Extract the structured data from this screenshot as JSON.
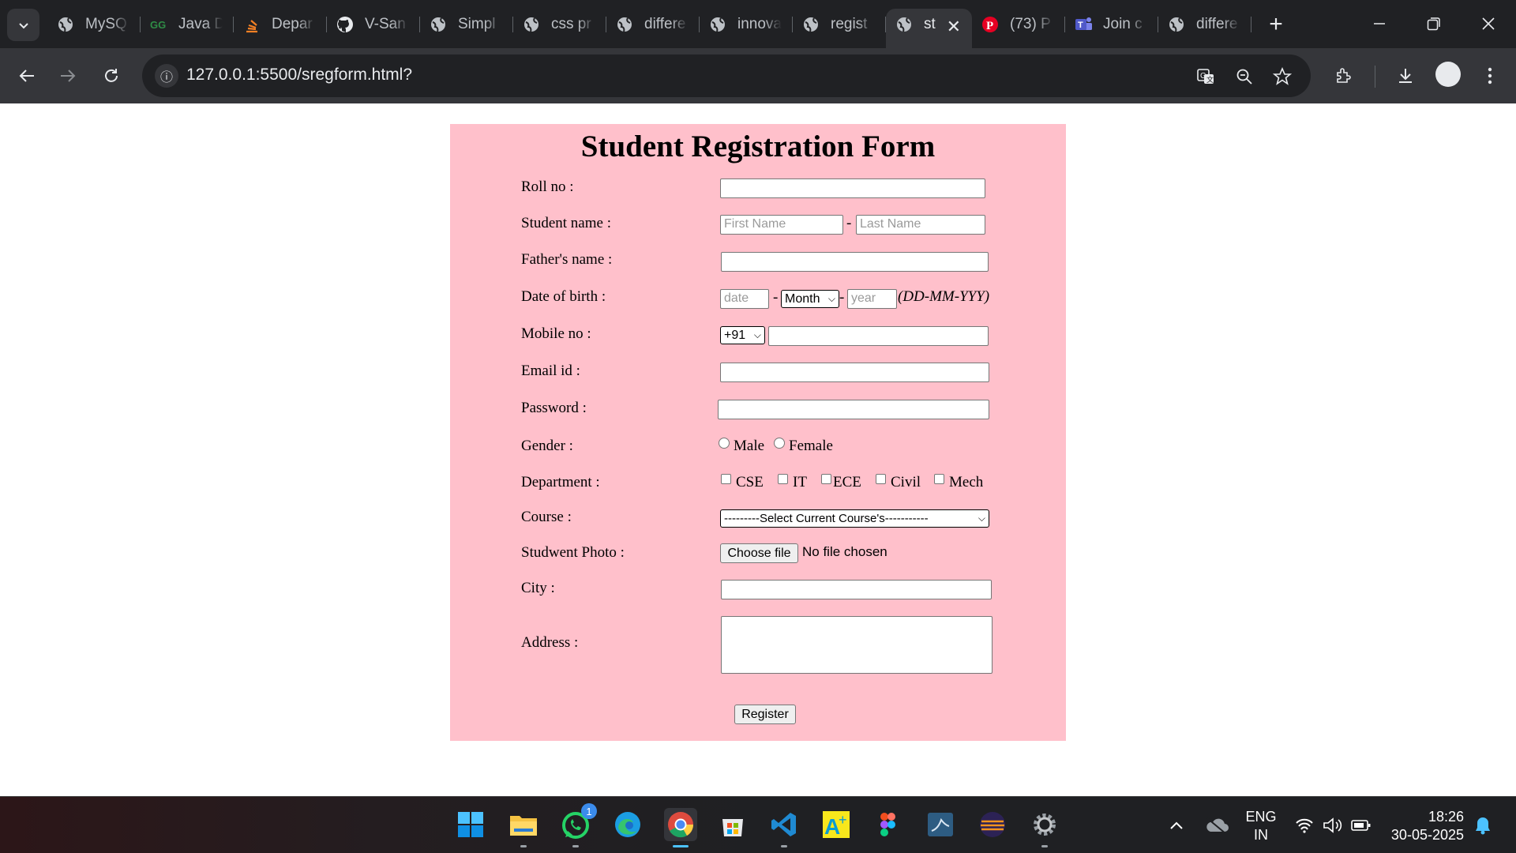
{
  "browser": {
    "tabs": [
      {
        "title": "MySQ",
        "icon": "globe-icon"
      },
      {
        "title": "Java D",
        "icon": "gfg-icon"
      },
      {
        "title": "Depar",
        "icon": "stack-icon"
      },
      {
        "title": "V-San",
        "icon": "github-icon"
      },
      {
        "title": "Simpl",
        "icon": "globe-icon"
      },
      {
        "title": "css pr",
        "icon": "globe-icon"
      },
      {
        "title": "differe",
        "icon": "globe-icon"
      },
      {
        "title": "innova",
        "icon": "globe-icon"
      },
      {
        "title": "regist",
        "icon": "globe-icon"
      },
      {
        "title": "st",
        "icon": "globe-icon",
        "active": true
      },
      {
        "title": "(73) P",
        "icon": "pinterest-icon"
      },
      {
        "title": "Join c",
        "icon": "teams-icon"
      },
      {
        "title": "differe",
        "icon": "globe-icon"
      }
    ],
    "url": "127.0.0.1:5500/sregform.html?"
  },
  "form": {
    "title": "Student Registration Form",
    "labels": {
      "roll": "Roll no :",
      "name": "Student name :",
      "father": "Father's name :",
      "dob": "Date of birth :",
      "mobile": "Mobile no :",
      "email": "Email id :",
      "password": "Password :",
      "gender": "Gender :",
      "department": "Department :",
      "course": "Course :",
      "photo": "Studwent Photo :",
      "city": "City :",
      "address": "Address :"
    },
    "placeholders": {
      "first": "First Name",
      "last": "Last Name",
      "date": "date",
      "year": "year"
    },
    "dash": "-",
    "month_select": "Month",
    "dob_hint": "(DD-MM-YYY)",
    "country_code": "+91",
    "genders": [
      "Male",
      "Female"
    ],
    "departments": [
      "CSE",
      "IT",
      "ECE",
      "Civil",
      "Mech"
    ],
    "course_select": "---------Select Current Course's-----------",
    "file_button": "Choose file",
    "file_status": "No file chosen",
    "register": "Register"
  },
  "taskbar": {
    "whatsapp_badge": "1",
    "lang": "ENG",
    "region": "IN",
    "time": "18:26",
    "date": "30-05-2025"
  },
  "colors": {
    "form_bg": "#ffc0cb",
    "chrome_dark": "#202124",
    "chrome_toolbar": "#35363a"
  }
}
